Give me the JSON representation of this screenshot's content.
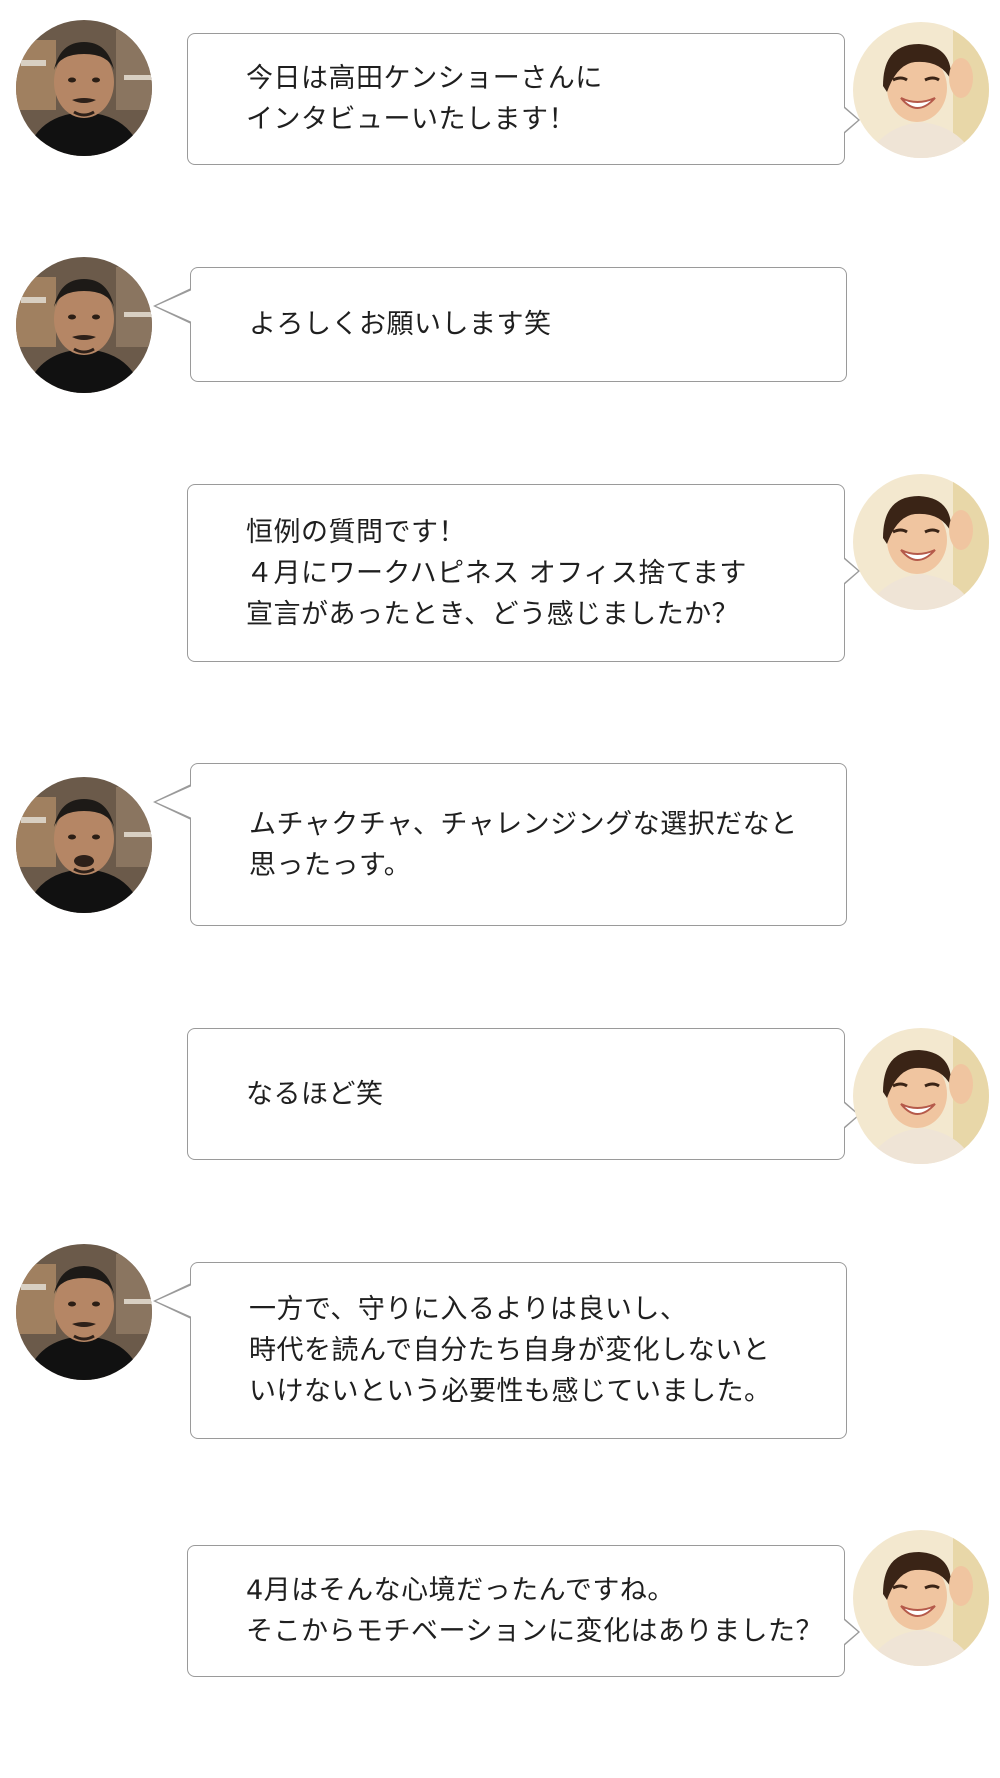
{
  "conversation": {
    "messages": [
      {
        "speaker": "interviewer",
        "side": "right",
        "lines": [
          "今日は高田ケンショーさんに",
          "インタビューいたします！"
        ]
      },
      {
        "speaker": "interviewee",
        "side": "left",
        "lines": [
          "よろしくお願いします笑"
        ]
      },
      {
        "speaker": "interviewer",
        "side": "right",
        "lines": [
          "恒例の質問です！",
          "４月にワークハピネス オフィス捨てます",
          "宣言があったとき、どう感じましたか？"
        ]
      },
      {
        "speaker": "interviewee",
        "side": "left",
        "lines": [
          "ムチャクチャ、チャレンジングな選択だなと",
          "思ったっす。"
        ]
      },
      {
        "speaker": "interviewer",
        "side": "right",
        "lines": [
          "なるほど笑"
        ]
      },
      {
        "speaker": "interviewee",
        "side": "left",
        "lines": [
          "一方で、守りに入るよりは良いし、",
          "時代を読んで自分たち自身が変化しないと",
          "いけないという必要性も感じていました。"
        ]
      },
      {
        "speaker": "interviewer",
        "side": "right",
        "lines": [
          "4月はそんな心境だったんですね。",
          "そこからモチベーションに変化はありました？"
        ]
      }
    ]
  },
  "colors": {
    "bubble_border": "#9a9a9a",
    "text": "#1f1f1f",
    "background": "#ffffff"
  }
}
